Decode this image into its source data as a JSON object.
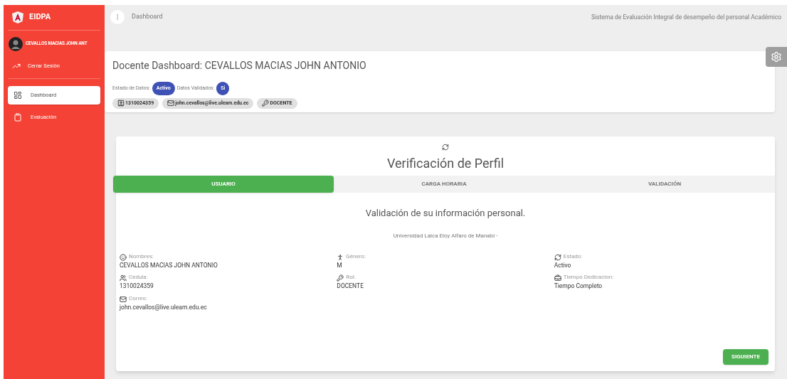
{
  "app": {
    "title": "EIDPA"
  },
  "user": {
    "name": "CEVALLOS MACIAS JOHN ANT"
  },
  "logout": {
    "label": "Cerrar Sesión"
  },
  "sidebar": {
    "items": [
      {
        "label": "Dashboard",
        "kind": "dashboard",
        "selected": true
      },
      {
        "label": "Evaluación",
        "kind": "clipboard",
        "selected": false
      }
    ]
  },
  "topbar": {
    "breadcrumb": "Dashboard",
    "system_name": "Sistema de Evaluación Integral de desempeño del personal Académico"
  },
  "header_card": {
    "title": "Docente Dashboard: CEVALLOS MACIAS JOHN ANTONIO",
    "status": [
      {
        "label": "Estado de Datos:",
        "badge": "Activo"
      },
      {
        "label": "Datos Validados:",
        "badge": "Si"
      }
    ],
    "chips": [
      {
        "kind": "id",
        "text": "1310024359"
      },
      {
        "kind": "mail",
        "text": "john.cevallos@live.uleam.edu.ec"
      },
      {
        "kind": "key",
        "text": "DOCENTE"
      }
    ]
  },
  "profile": {
    "title": "Verificación de Perfil",
    "tabs": [
      {
        "label": "USUARIO",
        "selected": true
      },
      {
        "label": "CARGA HORARIA",
        "selected": false
      },
      {
        "label": "VALIDACIÓN",
        "selected": false
      }
    ],
    "heading": "Validación de su información personal.",
    "subheading": "Universidad Laica Eloy Alfaro de Manabí -",
    "columns": [
      [
        {
          "kind": "face",
          "label": "Nombres:",
          "value": "CEVALLOS MACIAS JOHN ANTONIO"
        },
        {
          "kind": "id",
          "label": "Cedula:",
          "value": "1310024359"
        },
        {
          "kind": "mail",
          "label": "Correo:",
          "value": "john.cevallos@live.uleam.edu.ec"
        }
      ],
      [
        {
          "kind": "person",
          "label": "Género:",
          "value": "M"
        },
        {
          "kind": "key",
          "label": "Rol:",
          "value": "DOCENTE"
        }
      ],
      [
        {
          "kind": "refresh",
          "label": "Estado:",
          "value": "Activo"
        },
        {
          "kind": "briefcase",
          "label": "Tiempo Dedicacion:",
          "value": "Tiempo Completo"
        }
      ]
    ],
    "next_button": "SIGUIENTE"
  }
}
